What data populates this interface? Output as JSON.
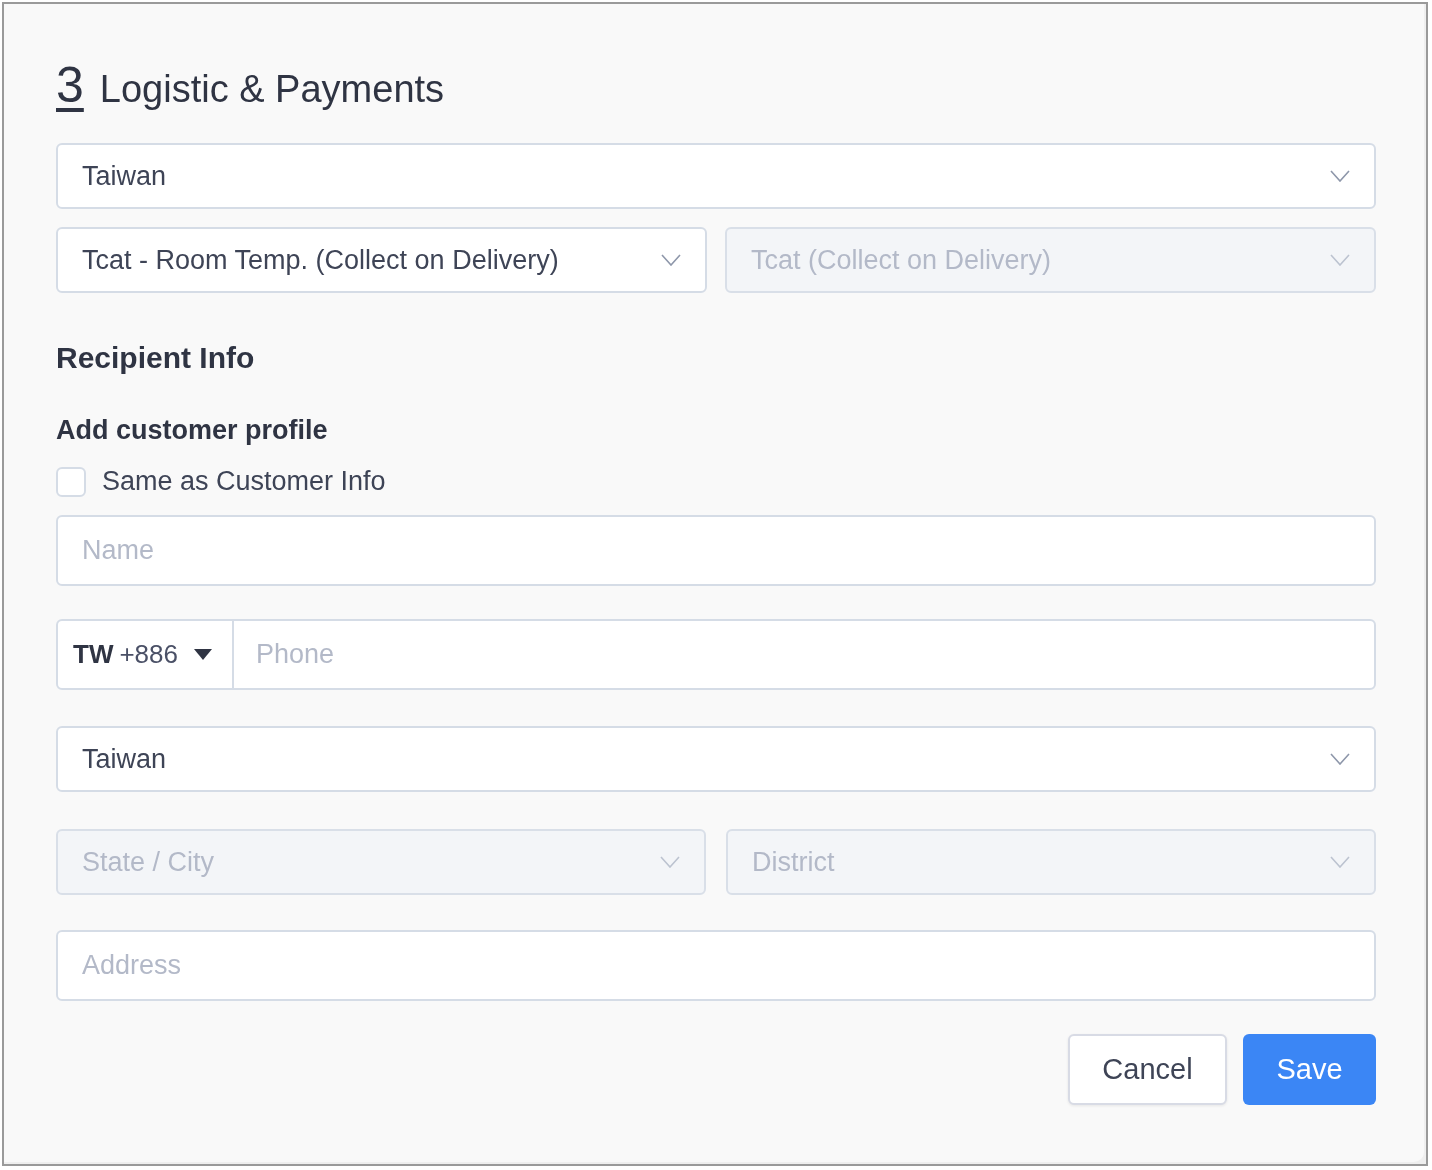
{
  "section": {
    "number": "3",
    "title": "Logistic & Payments"
  },
  "country_select": {
    "value": "Taiwan",
    "disabled": false
  },
  "delivery_selects": [
    {
      "value": "Tcat - Room Temp. (Collect on Delivery)",
      "disabled": false
    },
    {
      "value": "Tcat (Collect on Delivery)",
      "disabled": true
    }
  ],
  "recipient_heading": "Recipient Info",
  "profile_heading": "Add customer profile",
  "same_as_customer": {
    "label": "Same as Customer Info",
    "checked": false
  },
  "name_field": {
    "placeholder": "Name"
  },
  "phone": {
    "country_code": "TW",
    "dial_code": "+886",
    "placeholder": "Phone"
  },
  "recipient_country": {
    "value": "Taiwan",
    "disabled": false
  },
  "region_selects": [
    {
      "placeholder": "State / City",
      "disabled": true
    },
    {
      "placeholder": "District",
      "disabled": true
    }
  ],
  "address_field": {
    "placeholder": "Address"
  },
  "buttons": [
    {
      "label": "Cancel",
      "kind": "secondary"
    },
    {
      "label": "Save",
      "kind": "primary"
    }
  ]
}
